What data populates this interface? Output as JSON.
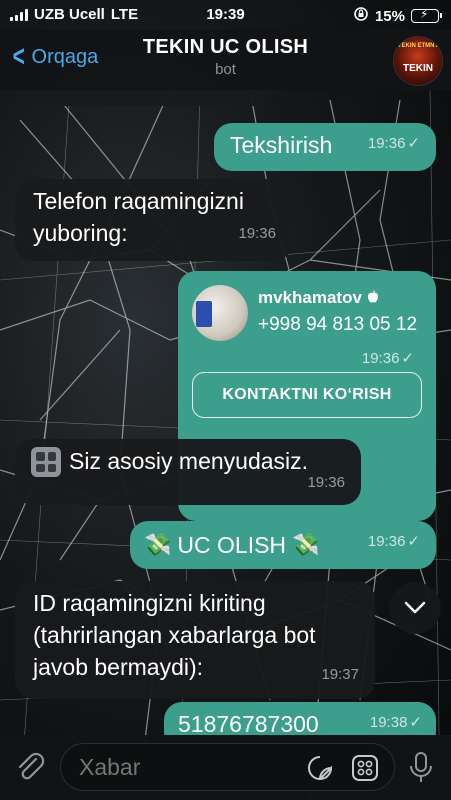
{
  "status_bar": {
    "carrier": "UZB Ucell",
    "network": "LTE",
    "time": "19:39",
    "battery": "15%",
    "battery_level": 0.15
  },
  "header": {
    "back_label": "Orqaga",
    "title": "TEKIN UC OLISH",
    "subtitle": "bot",
    "avatar_top_text": "TEKIN ETMNT",
    "avatar_text": "TEKIN"
  },
  "messages": [
    {
      "text": "Tekshirish",
      "time": "19:36",
      "direction": "out"
    },
    {
      "text": "Telefon raqamingizni yuboring:",
      "time": "19:36",
      "direction": "in"
    },
    {
      "type": "contact",
      "name": "mvkhamatov",
      "phone": "+998 94 813 05 12",
      "time": "19:36",
      "button": "KONTAKTNI KO‘RISH",
      "direction": "out"
    },
    {
      "text": "Siz asosiy menyudasiz.",
      "time": "19:36",
      "direction": "in"
    },
    {
      "text": "UC OLISH",
      "emoji": "💸",
      "time": "19:36",
      "direction": "out"
    },
    {
      "text": "ID raqamingizni kiriting (tahrirlangan xabarlarga bot javob bermaydi):",
      "time": "19:37",
      "direction": "in"
    },
    {
      "text": "51876787300",
      "time": "19:38",
      "direction": "out"
    }
  ],
  "composer": {
    "placeholder": "Xabar"
  },
  "colors": {
    "accent": "#4aa8e8",
    "outgoing_bubble": "#3c9e8d",
    "incoming_bubble": "#181a1c"
  }
}
